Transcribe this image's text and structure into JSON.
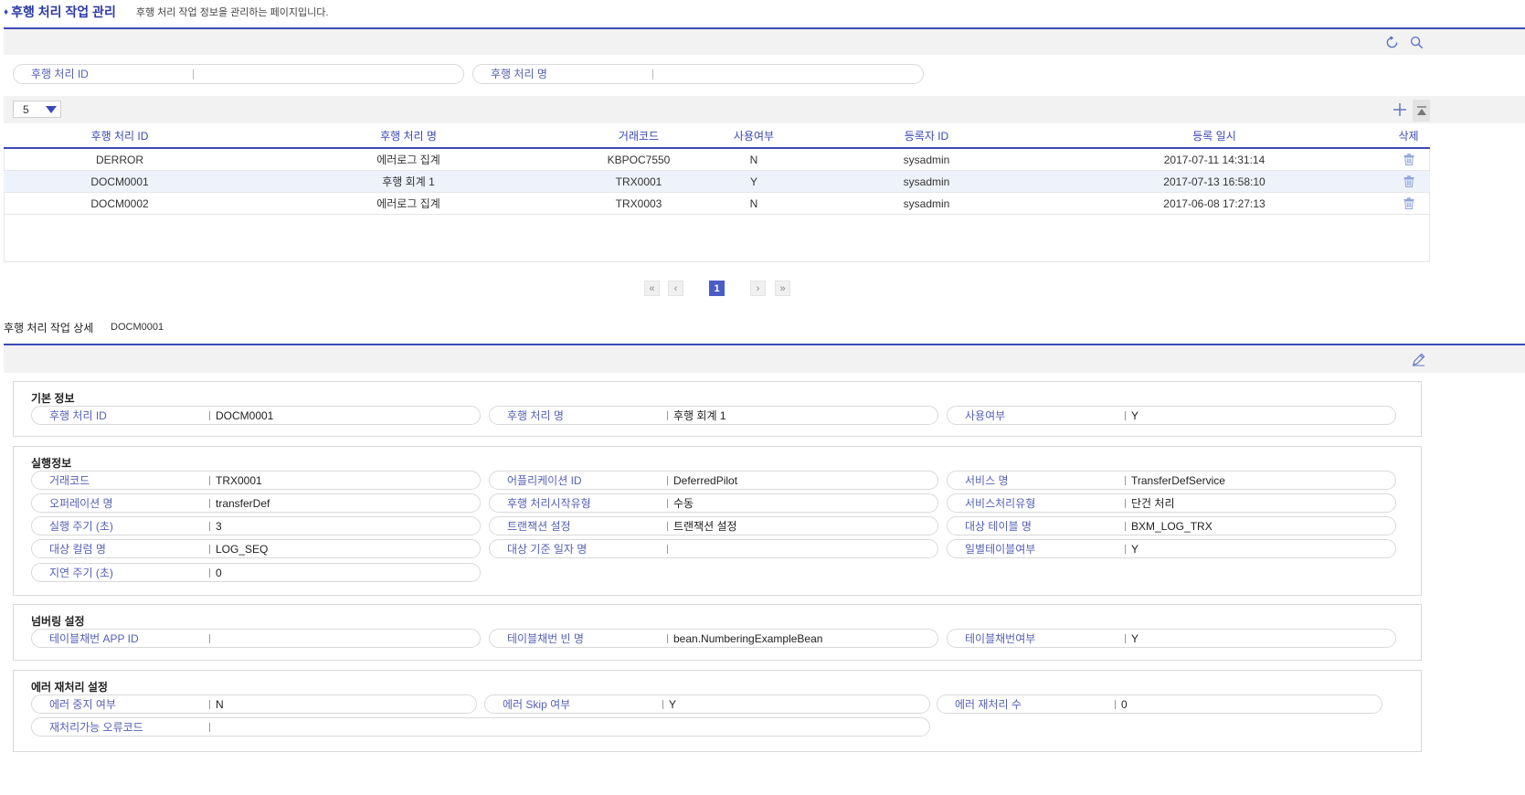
{
  "header": {
    "title": "후행 처리 작업 관리",
    "description": "후행 처리 작업 정보을 관리하는 페이지입니다."
  },
  "search": {
    "fields": [
      {
        "label": "후행 처리 ID",
        "value": ""
      },
      {
        "label": "후행 처리 명",
        "value": ""
      }
    ]
  },
  "grid": {
    "page_size": "5",
    "columns": [
      "후행 처리 ID",
      "후행 처리 명",
      "거래코드",
      "사용여부",
      "등록자 ID",
      "등록 일시",
      "삭제"
    ],
    "rows": [
      {
        "id": "DERROR",
        "name": "에러로그 집계",
        "code": "KBPOC7550",
        "use": "N",
        "user": "sysadmin",
        "date": "2017-07-11 14:31:14"
      },
      {
        "id": "DOCM0001",
        "name": "후행 회계 1",
        "code": "TRX0001",
        "use": "Y",
        "user": "sysadmin",
        "date": "2017-07-13 16:58:10"
      },
      {
        "id": "DOCM0002",
        "name": "에러로그 집계",
        "code": "TRX0003",
        "use": "N",
        "user": "sysadmin",
        "date": "2017-06-08 17:27:13"
      }
    ]
  },
  "pager": {
    "first": "«",
    "prev": "‹",
    "current": "1",
    "next": "›",
    "last": "»"
  },
  "detail": {
    "title": "후행 처리 작업 상세",
    "selected_id": "DOCM0001",
    "sections": {
      "basic": {
        "title": "기본 정보",
        "fields": [
          {
            "label": "후행 처리 ID",
            "value": "DOCM0001"
          },
          {
            "label": "후행 처리 명",
            "value": "후행 회계 1"
          },
          {
            "label": "사용여부",
            "value": "Y"
          }
        ]
      },
      "exec": {
        "title": "실행정보",
        "fields": [
          {
            "label": "거래코드",
            "value": "TRX0001"
          },
          {
            "label": "어플리케이션 ID",
            "value": "DeferredPilot"
          },
          {
            "label": "서비스 명",
            "value": "TransferDefService"
          },
          {
            "label": "오퍼레이션 명",
            "value": "transferDef"
          },
          {
            "label": "후행 처리시작유형",
            "value": "수동"
          },
          {
            "label": "서비스처리유형",
            "value": "단건 처리"
          },
          {
            "label": "실행 주기 (초)",
            "value": "3"
          },
          {
            "label": "트랜잭션 설정",
            "value": "트랜잭션 설정"
          },
          {
            "label": "대상 테이블 명",
            "value": "BXM_LOG_TRX"
          },
          {
            "label": "대상 컬럼 명",
            "value": "LOG_SEQ"
          },
          {
            "label": "대상 기준 일자 명",
            "value": ""
          },
          {
            "label": "일별테이블여부",
            "value": "Y"
          },
          {
            "label": "지연 주기 (초)",
            "value": "0"
          }
        ]
      },
      "numbering": {
        "title": "넘버링 설정",
        "fields": [
          {
            "label": "테이블채번 APP ID",
            "value": ""
          },
          {
            "label": "테이블채번 빈 명",
            "value": "bean.NumberingExampleBean"
          },
          {
            "label": "테이블채번여부",
            "value": "Y"
          }
        ]
      },
      "error": {
        "title": "에러 재처리 설정",
        "fields": [
          {
            "label": "에러 중지 여부",
            "value": "N"
          },
          {
            "label": "에러 Skip 여부",
            "value": "Y"
          },
          {
            "label": "에러 재처리 수",
            "value": "0"
          },
          {
            "label": "재처리가능 오류코드",
            "value": ""
          }
        ]
      }
    }
  },
  "colors": {
    "accent": "#3b49b6",
    "label": "#5560b8",
    "selected_row": "#eef2fb"
  }
}
